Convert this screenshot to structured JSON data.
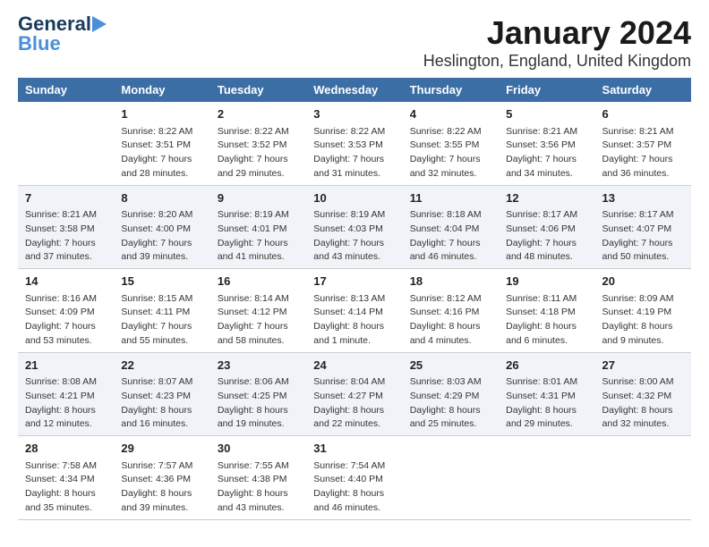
{
  "header": {
    "logo_general": "General",
    "logo_blue": "Blue",
    "month_title": "January 2024",
    "location": "Heslington, England, United Kingdom"
  },
  "days_of_week": [
    "Sunday",
    "Monday",
    "Tuesday",
    "Wednesday",
    "Thursday",
    "Friday",
    "Saturday"
  ],
  "weeks": [
    [
      {
        "day": "",
        "sunrise": "",
        "sunset": "",
        "daylight": ""
      },
      {
        "day": "1",
        "sunrise": "Sunrise: 8:22 AM",
        "sunset": "Sunset: 3:51 PM",
        "daylight": "Daylight: 7 hours and 28 minutes."
      },
      {
        "day": "2",
        "sunrise": "Sunrise: 8:22 AM",
        "sunset": "Sunset: 3:52 PM",
        "daylight": "Daylight: 7 hours and 29 minutes."
      },
      {
        "day": "3",
        "sunrise": "Sunrise: 8:22 AM",
        "sunset": "Sunset: 3:53 PM",
        "daylight": "Daylight: 7 hours and 31 minutes."
      },
      {
        "day": "4",
        "sunrise": "Sunrise: 8:22 AM",
        "sunset": "Sunset: 3:55 PM",
        "daylight": "Daylight: 7 hours and 32 minutes."
      },
      {
        "day": "5",
        "sunrise": "Sunrise: 8:21 AM",
        "sunset": "Sunset: 3:56 PM",
        "daylight": "Daylight: 7 hours and 34 minutes."
      },
      {
        "day": "6",
        "sunrise": "Sunrise: 8:21 AM",
        "sunset": "Sunset: 3:57 PM",
        "daylight": "Daylight: 7 hours and 36 minutes."
      }
    ],
    [
      {
        "day": "7",
        "sunrise": "Sunrise: 8:21 AM",
        "sunset": "Sunset: 3:58 PM",
        "daylight": "Daylight: 7 hours and 37 minutes."
      },
      {
        "day": "8",
        "sunrise": "Sunrise: 8:20 AM",
        "sunset": "Sunset: 4:00 PM",
        "daylight": "Daylight: 7 hours and 39 minutes."
      },
      {
        "day": "9",
        "sunrise": "Sunrise: 8:19 AM",
        "sunset": "Sunset: 4:01 PM",
        "daylight": "Daylight: 7 hours and 41 minutes."
      },
      {
        "day": "10",
        "sunrise": "Sunrise: 8:19 AM",
        "sunset": "Sunset: 4:03 PM",
        "daylight": "Daylight: 7 hours and 43 minutes."
      },
      {
        "day": "11",
        "sunrise": "Sunrise: 8:18 AM",
        "sunset": "Sunset: 4:04 PM",
        "daylight": "Daylight: 7 hours and 46 minutes."
      },
      {
        "day": "12",
        "sunrise": "Sunrise: 8:17 AM",
        "sunset": "Sunset: 4:06 PM",
        "daylight": "Daylight: 7 hours and 48 minutes."
      },
      {
        "day": "13",
        "sunrise": "Sunrise: 8:17 AM",
        "sunset": "Sunset: 4:07 PM",
        "daylight": "Daylight: 7 hours and 50 minutes."
      }
    ],
    [
      {
        "day": "14",
        "sunrise": "Sunrise: 8:16 AM",
        "sunset": "Sunset: 4:09 PM",
        "daylight": "Daylight: 7 hours and 53 minutes."
      },
      {
        "day": "15",
        "sunrise": "Sunrise: 8:15 AM",
        "sunset": "Sunset: 4:11 PM",
        "daylight": "Daylight: 7 hours and 55 minutes."
      },
      {
        "day": "16",
        "sunrise": "Sunrise: 8:14 AM",
        "sunset": "Sunset: 4:12 PM",
        "daylight": "Daylight: 7 hours and 58 minutes."
      },
      {
        "day": "17",
        "sunrise": "Sunrise: 8:13 AM",
        "sunset": "Sunset: 4:14 PM",
        "daylight": "Daylight: 8 hours and 1 minute."
      },
      {
        "day": "18",
        "sunrise": "Sunrise: 8:12 AM",
        "sunset": "Sunset: 4:16 PM",
        "daylight": "Daylight: 8 hours and 4 minutes."
      },
      {
        "day": "19",
        "sunrise": "Sunrise: 8:11 AM",
        "sunset": "Sunset: 4:18 PM",
        "daylight": "Daylight: 8 hours and 6 minutes."
      },
      {
        "day": "20",
        "sunrise": "Sunrise: 8:09 AM",
        "sunset": "Sunset: 4:19 PM",
        "daylight": "Daylight: 8 hours and 9 minutes."
      }
    ],
    [
      {
        "day": "21",
        "sunrise": "Sunrise: 8:08 AM",
        "sunset": "Sunset: 4:21 PM",
        "daylight": "Daylight: 8 hours and 12 minutes."
      },
      {
        "day": "22",
        "sunrise": "Sunrise: 8:07 AM",
        "sunset": "Sunset: 4:23 PM",
        "daylight": "Daylight: 8 hours and 16 minutes."
      },
      {
        "day": "23",
        "sunrise": "Sunrise: 8:06 AM",
        "sunset": "Sunset: 4:25 PM",
        "daylight": "Daylight: 8 hours and 19 minutes."
      },
      {
        "day": "24",
        "sunrise": "Sunrise: 8:04 AM",
        "sunset": "Sunset: 4:27 PM",
        "daylight": "Daylight: 8 hours and 22 minutes."
      },
      {
        "day": "25",
        "sunrise": "Sunrise: 8:03 AM",
        "sunset": "Sunset: 4:29 PM",
        "daylight": "Daylight: 8 hours and 25 minutes."
      },
      {
        "day": "26",
        "sunrise": "Sunrise: 8:01 AM",
        "sunset": "Sunset: 4:31 PM",
        "daylight": "Daylight: 8 hours and 29 minutes."
      },
      {
        "day": "27",
        "sunrise": "Sunrise: 8:00 AM",
        "sunset": "Sunset: 4:32 PM",
        "daylight": "Daylight: 8 hours and 32 minutes."
      }
    ],
    [
      {
        "day": "28",
        "sunrise": "Sunrise: 7:58 AM",
        "sunset": "Sunset: 4:34 PM",
        "daylight": "Daylight: 8 hours and 35 minutes."
      },
      {
        "day": "29",
        "sunrise": "Sunrise: 7:57 AM",
        "sunset": "Sunset: 4:36 PM",
        "daylight": "Daylight: 8 hours and 39 minutes."
      },
      {
        "day": "30",
        "sunrise": "Sunrise: 7:55 AM",
        "sunset": "Sunset: 4:38 PM",
        "daylight": "Daylight: 8 hours and 43 minutes."
      },
      {
        "day": "31",
        "sunrise": "Sunrise: 7:54 AM",
        "sunset": "Sunset: 4:40 PM",
        "daylight": "Daylight: 8 hours and 46 minutes."
      },
      {
        "day": "",
        "sunrise": "",
        "sunset": "",
        "daylight": ""
      },
      {
        "day": "",
        "sunrise": "",
        "sunset": "",
        "daylight": ""
      },
      {
        "day": "",
        "sunrise": "",
        "sunset": "",
        "daylight": ""
      }
    ]
  ]
}
